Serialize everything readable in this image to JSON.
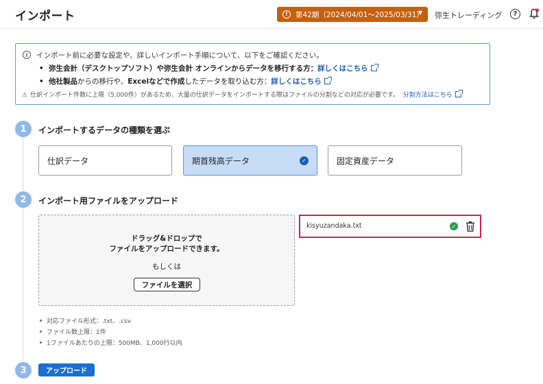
{
  "header": {
    "title": "インポート",
    "period_label": "第42期（2024/04/01〜2025/03/31）",
    "company_name": "弥生トレーディング"
  },
  "info": {
    "intro": "インポート前に必要な設定や、詳しいインポート手順について、以下をご確認ください。",
    "bullet1_text": "弥生会計（デスクトップソフト）や弥生会計 オンラインからデータを移行する方：",
    "bullet1_link": "詳しくはこちら",
    "bullet2_pre": "他社製品",
    "bullet2_mid1": "からの移行や、",
    "bullet2_excel": "Excelなどで作成",
    "bullet2_mid2": "したデータを取り込む方：",
    "bullet2_link": "詳しくはこちら",
    "note_text": "仕訳インポート件数に上限（5,000件）があるため、大量の仕訳データをインポートする際はファイルの分割などの対応が必要です。",
    "note_link": "分割方法はこちら"
  },
  "steps": [
    {
      "number": "1",
      "title": "インポートするデータの種類を選ぶ"
    },
    {
      "number": "2",
      "title": "インポート用ファイルをアップロード"
    },
    {
      "number": "3"
    }
  ],
  "data_types": [
    {
      "label": "仕訳データ",
      "selected": false
    },
    {
      "label": "期首残高データ",
      "selected": true
    },
    {
      "label": "固定資産データ",
      "selected": false
    }
  ],
  "dropzone": {
    "line1": "ドラッグ&ドロップで",
    "line2": "ファイルをアップロードできます。",
    "or_text": "もしくは",
    "select_button": "ファイルを選択"
  },
  "uploaded_file": {
    "name": "kisyuzandaka.txt"
  },
  "specs": [
    "対応ファイル形式：.txt、.csv",
    "ファイル数上限：1件",
    "1ファイルあたりの上限：500MB、1,000行以内"
  ],
  "upload_button": "アップロード",
  "colors": {
    "period_badge": "#c4600f",
    "accent": "#1a5fb4",
    "step_circle": "#8fb9e8",
    "selected_card": "#c7dcf5",
    "highlight_border": "#c8254a",
    "success": "#2e9e4f"
  },
  "icons": [
    "warning-icon",
    "chevron-down-icon",
    "help-icon",
    "bell-icon",
    "info-icon",
    "external-link-icon",
    "alert-triangle-icon",
    "check-circle-icon",
    "trash-icon"
  ]
}
